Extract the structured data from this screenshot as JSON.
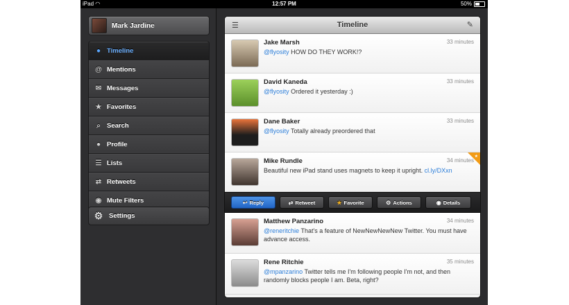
{
  "status_bar": {
    "device": "iPad",
    "time": "12:57 PM",
    "battery": "50%",
    "battery_level": 0.5
  },
  "sidebar": {
    "account_name": "Mark Jardine",
    "items": [
      {
        "label": "Timeline",
        "icon": "speech-bubble-icon",
        "active": true
      },
      {
        "label": "Mentions",
        "icon": "at-sign-icon"
      },
      {
        "label": "Messages",
        "icon": "envelope-icon"
      },
      {
        "label": "Favorites",
        "icon": "star-icon"
      },
      {
        "label": "Search",
        "icon": "magnifier-icon"
      },
      {
        "label": "Profile",
        "icon": "person-icon"
      },
      {
        "label": "Lists",
        "icon": "list-icon"
      },
      {
        "label": "Retweets",
        "icon": "retweet-icon"
      },
      {
        "label": "Mute Filters",
        "icon": "mute-icon"
      }
    ],
    "settings_label": "Settings"
  },
  "timeline": {
    "title": "Timeline",
    "tweets": [
      {
        "author": "Jake Marsh",
        "time": "33 minutes",
        "mention": "@flyosity",
        "text": " HOW DO THEY WORK!?"
      },
      {
        "author": "David Kaneda",
        "time": "33 minutes",
        "mention": "@flyosity",
        "text": " Ordered it yesterday :)"
      },
      {
        "author": "Dane Baker",
        "time": "33 minutes",
        "mention": "@flyosity",
        "text": " Totally already preordered that"
      },
      {
        "author": "Mike Rundle",
        "time": "34 minutes",
        "text": "Beautiful new iPad stand uses magnets to keep it upright. ",
        "link": "cl.ly/DXxn"
      },
      {
        "author": "Matthew Panzarino",
        "time": "34 minutes",
        "mention": "@reneritchie",
        "text": " That's a feature of NewNewNewNew Twitter. You must have advance access."
      },
      {
        "author": "Rene Ritchie",
        "time": "35 minutes",
        "mention": "@mpanzarino",
        "text": " Twitter tells me I'm following people I'm not, and then randomly blocks people I am. Beta, right?"
      }
    ],
    "actions": {
      "reply": "Reply",
      "retweet": "Retweet",
      "favorite": "Favorite",
      "actions": "Actions",
      "details": "Details"
    }
  },
  "colors": {
    "accent": "#2b7dd8",
    "active_menu": "#6cb0ff",
    "corner_badge": "#f29b15"
  }
}
